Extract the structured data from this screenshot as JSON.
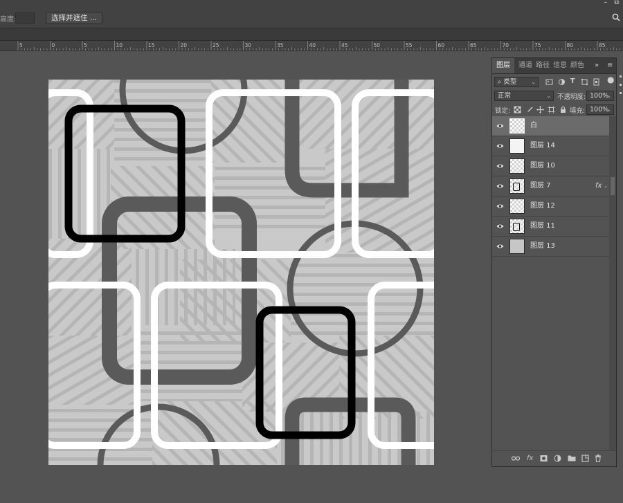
{
  "titlebar": {
    "minimize_icon": "minimize-icon",
    "restore_icon": "restore-icon"
  },
  "options_bar": {
    "feather_label": "高度:",
    "select_mask_button": "选择并遮住 ...",
    "search_icon": "search-icon"
  },
  "ruler": {
    "labels": [
      "5",
      "0",
      "5",
      "10",
      "15",
      "20",
      "25",
      "30",
      "35",
      "40",
      "45",
      "50",
      "55",
      "60",
      "65",
      "70",
      "75",
      "80",
      "85"
    ]
  },
  "layers_panel": {
    "tabs": [
      "图层",
      "通道",
      "路径",
      "信息",
      "颜色"
    ],
    "active_tab": "图层",
    "filter_kind": "类型",
    "blend_mode": "正常",
    "opacity_label": "不透明度:",
    "opacity_value": "100%",
    "lock_label": "锁定:",
    "fill_label": "填充:",
    "fill_value": "100%",
    "layers": [
      {
        "name": "白",
        "thumb": "checker-sel",
        "selected": true,
        "fx": false
      },
      {
        "name": "图层 14",
        "thumb": "white",
        "selected": false,
        "fx": false
      },
      {
        "name": "图层 10",
        "thumb": "checker",
        "selected": false,
        "fx": false
      },
      {
        "name": "图层 7",
        "thumb": "checker-shape",
        "selected": false,
        "fx": true
      },
      {
        "name": "图层 12",
        "thumb": "checker",
        "selected": false,
        "fx": false
      },
      {
        "name": "图层 11",
        "thumb": "checker-box",
        "selected": false,
        "fx": false
      },
      {
        "name": "图层 13",
        "thumb": "grey",
        "selected": false,
        "fx": false
      }
    ],
    "fx_label": "fx",
    "bottom_icons": [
      "link-icon",
      "fx-icon",
      "mask-icon",
      "adjustment-icon",
      "folder-icon",
      "new-layer-icon",
      "trash-icon"
    ]
  },
  "colors": {
    "app_bg": "#535353",
    "bar_bg": "#424242",
    "canvas_bg": "#c9c9c9",
    "stripe": "#b5b5b5",
    "dark_band": "#5a5a5a",
    "black_ring": "#000000",
    "white_ring": "#ffffff"
  }
}
